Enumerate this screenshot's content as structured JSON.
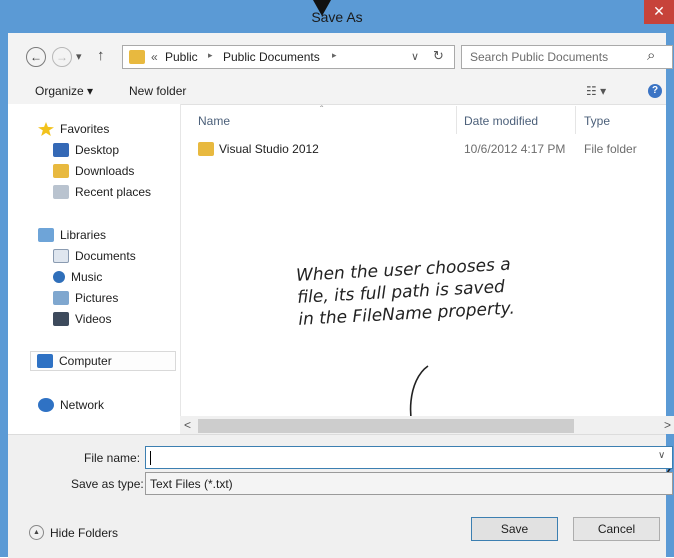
{
  "window": {
    "title": "Save As",
    "close_glyph": "✕"
  },
  "nav": {
    "back": "←",
    "forward": "→",
    "dropdown": "▾",
    "up": "↑"
  },
  "address": {
    "chevron_prefix": "«",
    "crumbs": [
      "Public",
      "Public Documents"
    ],
    "sep": "▸",
    "dropdown": "∨",
    "refresh": "↻"
  },
  "search": {
    "placeholder": "Search Public Documents",
    "icon": "search-icon",
    "glyph": "⌕"
  },
  "toolbar": {
    "organize": "Organize ▾",
    "new_folder": "New folder",
    "view_glyph": "☷ ▾",
    "help_glyph": "?"
  },
  "sidebar": {
    "favorites": {
      "label": "Favorites",
      "items": [
        "Desktop",
        "Downloads",
        "Recent places"
      ]
    },
    "libraries": {
      "label": "Libraries",
      "items": [
        "Documents",
        "Music",
        "Pictures",
        "Videos"
      ]
    },
    "computer": "Computer",
    "network": "Network"
  },
  "columns": {
    "name": "Name",
    "date": "Date modified",
    "type": "Type",
    "sort_glyph": "ˆ"
  },
  "files": [
    {
      "name": "Visual Studio 2012",
      "date": "10/6/2012 4:17 PM",
      "type": "File folder"
    }
  ],
  "scroll": {
    "left": "<",
    "right": ">"
  },
  "form": {
    "file_name_label": "File name:",
    "file_name_value": "",
    "save_type_label": "Save as type:",
    "save_type_value": "Text Files (*.txt)",
    "dropdown": "∨"
  },
  "footer": {
    "hide_folders": "Hide Folders",
    "save": "Save",
    "cancel": "Cancel",
    "toggle_glyph": "▲"
  },
  "annotation": {
    "lines": [
      "When the user chooses a",
      "file, its full path is saved",
      "in the FileName property."
    ]
  }
}
